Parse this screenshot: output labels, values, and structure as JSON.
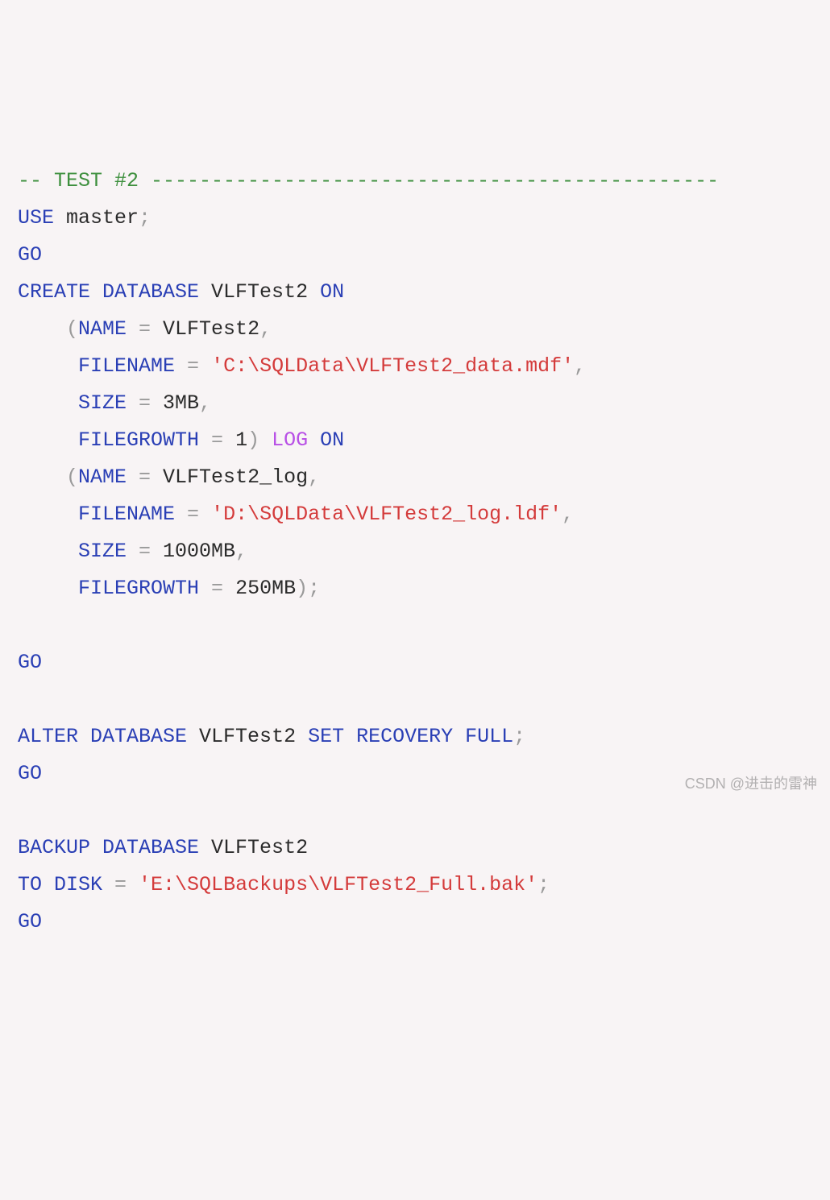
{
  "code": {
    "comment_prefix": "-- TEST #2 ",
    "comment_dashes": "-----------------------------------------------",
    "use_kw": "USE",
    "use_db": " master",
    "semi": ";",
    "go": "GO",
    "create_db_kw": "CREATE DATABASE",
    "vlftest2": " VLFTest2 ",
    "on_kw": "ON",
    "open_paren": "    (",
    "name_kw": "NAME",
    "eq": " = ",
    "name1_val": "VLFTest2",
    "comma": ",",
    "indent5": "     ",
    "filename_kw": "FILENAME",
    "str1": "'C:\\SQLData\\VLFTest2_data.mdf'",
    "size_kw": "SIZE",
    "size1_val": "3MB",
    "filegrowth_kw": "FILEGROWTH",
    "fg1_val": "1",
    "close_paren_sp": ") ",
    "log_kw": "LOG",
    "sp": " ",
    "name2_val": "VLFTest2_log",
    "str2": "'D:\\SQLData\\VLFTest2_log.ldf'",
    "size2_val": "1000MB",
    "fg2_val": "250MB",
    "close_paren": ")",
    "alter_db_kw": "ALTER DATABASE",
    "set_recovery_full_kw": "SET RECOVERY FULL",
    "backup_db_kw": "BACKUP DATABASE",
    "vlftest2_nl": " VLFTest2",
    "to_disk_kw": "TO DISK",
    "str3": "'E:\\SQLBackups\\VLFTest2_Full.bak'"
  },
  "watermark": "CSDN @进击的雷神"
}
